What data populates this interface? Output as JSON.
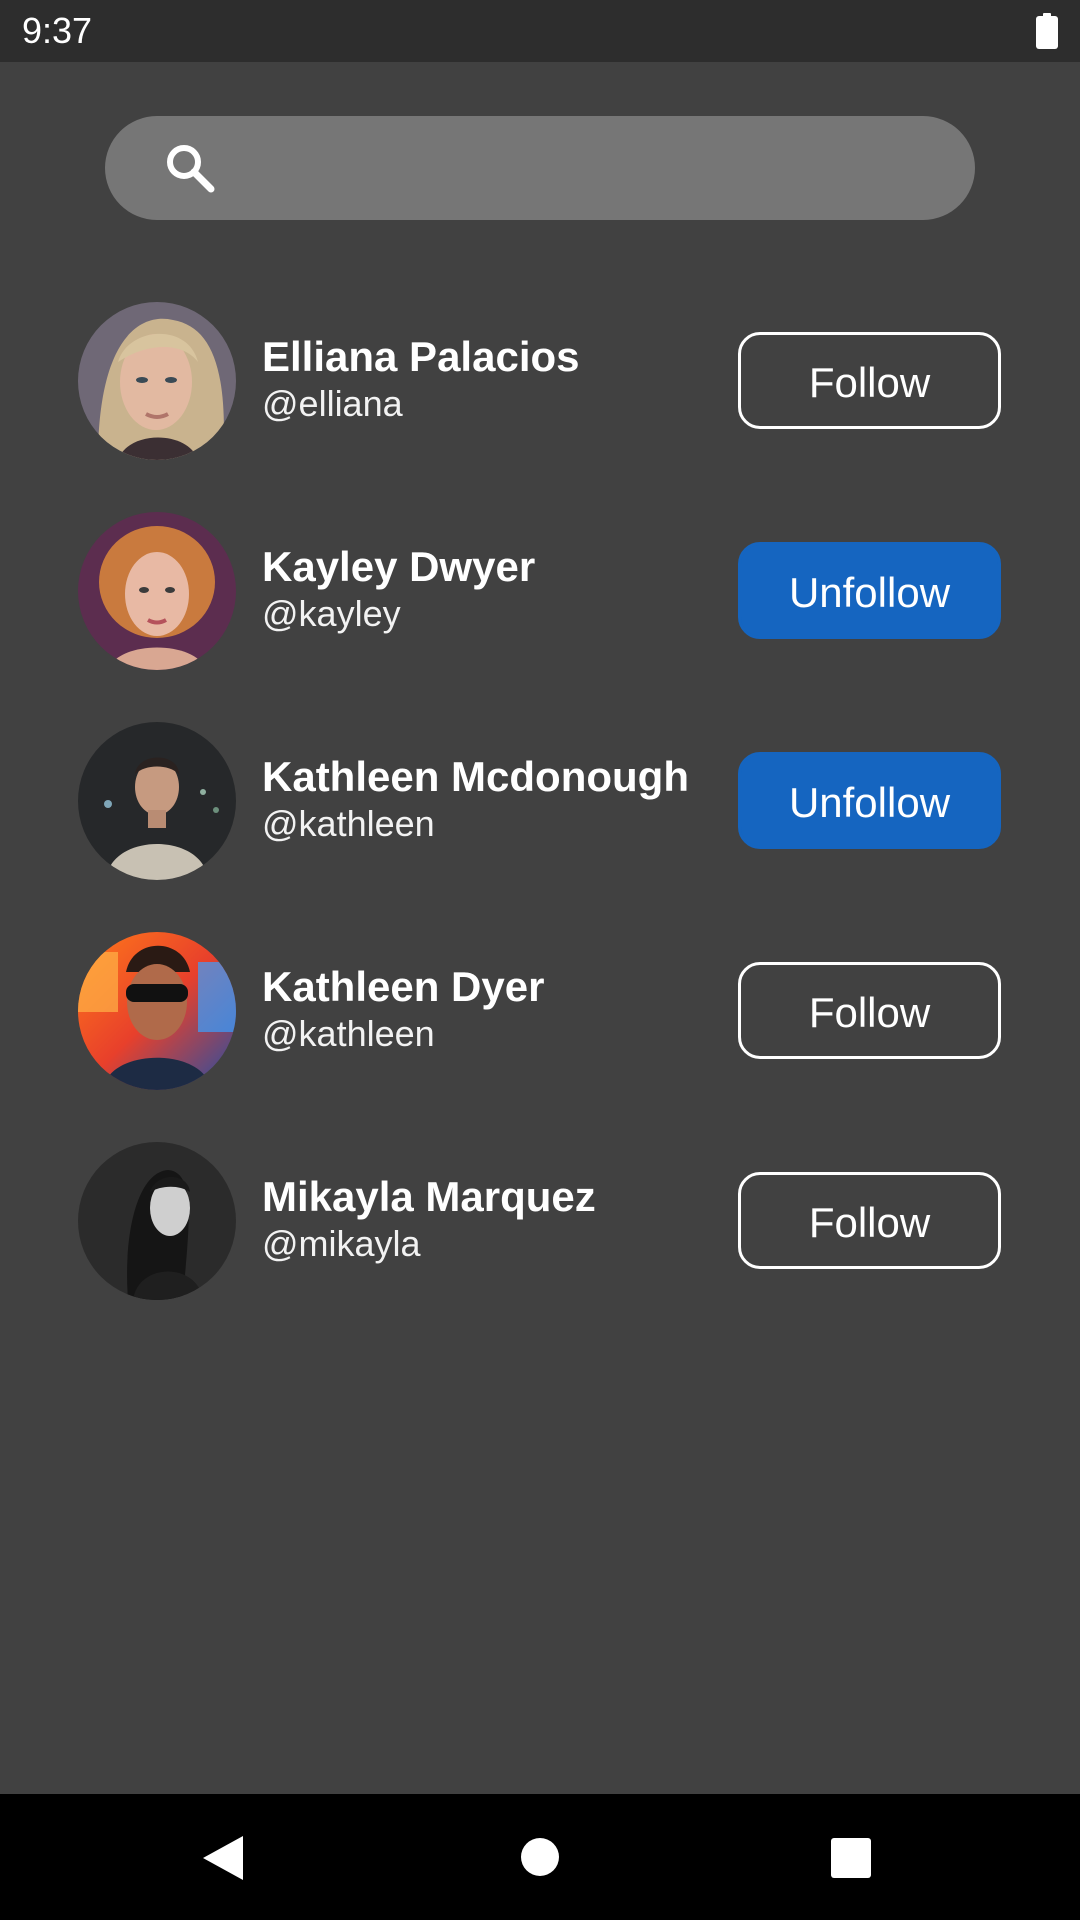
{
  "status_bar": {
    "time": "9:37",
    "battery_icon": "battery-full-icon"
  },
  "search": {
    "icon": "search-icon",
    "placeholder": "",
    "value": ""
  },
  "users": [
    {
      "name": "Elliana Palacios",
      "handle": "@elliana",
      "button_label": "Follow",
      "following": false
    },
    {
      "name": "Kayley Dwyer",
      "handle": "@kayley",
      "button_label": "Unfollow",
      "following": true
    },
    {
      "name": "Kathleen Mcdonough",
      "handle": "@kathleen",
      "button_label": "Unfollow",
      "following": true
    },
    {
      "name": "Kathleen Dyer",
      "handle": "@kathleen",
      "button_label": "Follow",
      "following": false
    },
    {
      "name": "Mikayla Marquez",
      "handle": "@mikayla",
      "button_label": "Follow",
      "following": false
    }
  ],
  "nav_bar": {
    "back_icon": "back-triangle-icon",
    "home_icon": "home-circle-icon",
    "recents_icon": "recents-square-icon"
  },
  "colors": {
    "background": "#414141",
    "status_bar": "#2d2d2d",
    "search_bar": "#767676",
    "unfollow_button": "#1565c0",
    "nav_bar": "#000000"
  }
}
